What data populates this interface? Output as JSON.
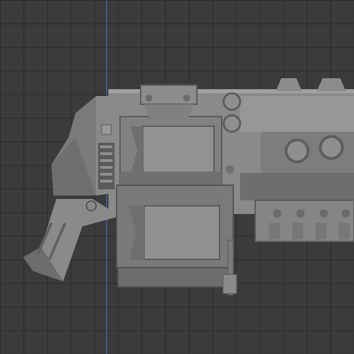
{
  "viewport": {
    "grid_color": "#2a2a2a",
    "background_color": "#3b3b3b",
    "axis_color": "#4b6fd6"
  },
  "model": {
    "icon": "gun-model-icon",
    "base_color": "#8c8c8c",
    "shadow_color": "#5f5f5f",
    "highlight_color": "#a4a4a4"
  }
}
